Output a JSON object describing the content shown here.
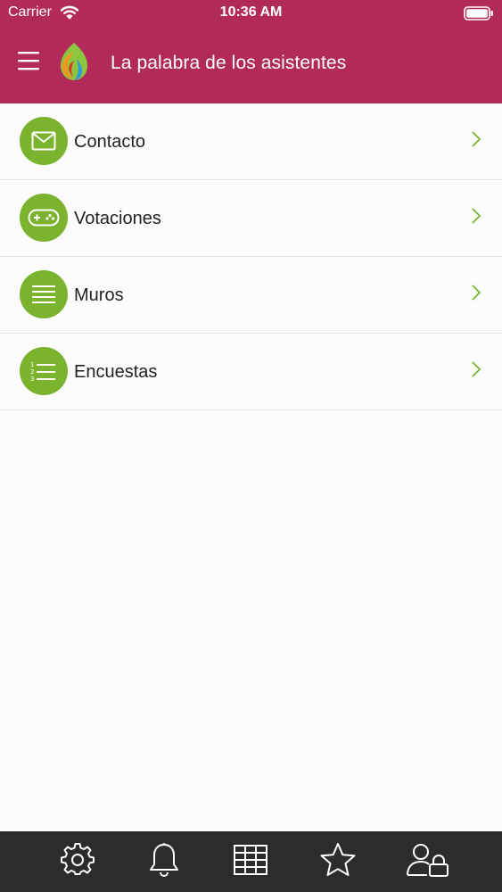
{
  "status_bar": {
    "carrier": "Carrier",
    "time": "10:36 AM"
  },
  "header": {
    "title": "La palabra de los asistentes",
    "background_color": "#b22a5a"
  },
  "menu": {
    "items": [
      {
        "label": "Contacto",
        "icon": "envelope-icon"
      },
      {
        "label": "Votaciones",
        "icon": "gamepad-icon"
      },
      {
        "label": "Muros",
        "icon": "lines-icon"
      },
      {
        "label": "Encuestas",
        "icon": "numbered-list-icon"
      }
    ],
    "icon_background_color": "#7cb32e",
    "chevron_color": "#7cb32e"
  },
  "tabbar": {
    "background_color": "#2b2c2e",
    "tabs": [
      {
        "icon": "gear-icon"
      },
      {
        "icon": "bell-icon"
      },
      {
        "icon": "grid-icon"
      },
      {
        "icon": "star-icon"
      },
      {
        "icon": "user-lock-icon"
      }
    ]
  }
}
